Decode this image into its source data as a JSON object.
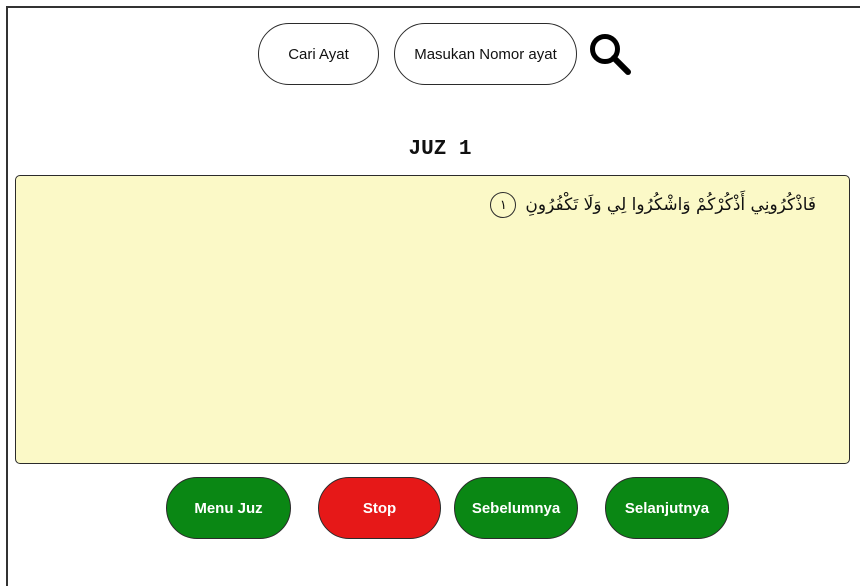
{
  "search": {
    "mode_label": "Cari Ayat",
    "input_placeholder": "Masukan Nomor ayat",
    "icon": "search-icon"
  },
  "page": {
    "title": "JUZ 1"
  },
  "verse": {
    "text": "فَاذْكُرُونِي أَذْكُرْكُمْ وَاشْكُرُوا لِي وَلَا تَكْفُرُونِ",
    "number": "١"
  },
  "controls": {
    "menu_juz": "Menu Juz",
    "stop": "Stop",
    "previous": "Sebelumnya",
    "next": "Selanjutnya"
  },
  "colors": {
    "panel_bg": "#fbf9c7",
    "green": "#0a8714",
    "red": "#e61818"
  }
}
